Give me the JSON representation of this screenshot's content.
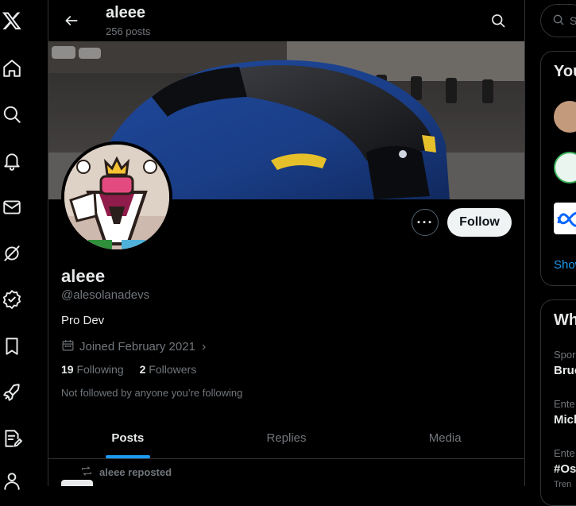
{
  "app": {
    "logo": "X"
  },
  "leftnav": [
    {
      "name": "x-logo-icon"
    },
    {
      "name": "home-icon"
    },
    {
      "name": "explore-search-icon"
    },
    {
      "name": "notifications-bell-icon"
    },
    {
      "name": "messages-envelope-icon"
    },
    {
      "name": "grok-icon"
    },
    {
      "name": "verified-icon"
    },
    {
      "name": "bookmarks-icon"
    },
    {
      "name": "jobs-rocket-icon"
    },
    {
      "name": "write-article-icon"
    },
    {
      "name": "profile-icon"
    }
  ],
  "header": {
    "title": "aleee",
    "subtitle": "256 posts"
  },
  "profile": {
    "name": "aleee",
    "handle": "@alesolanadevs",
    "bio": "Pro Dev",
    "joined": "Joined February 2021",
    "following_count": "19",
    "following_label": "Following",
    "followers_count": "2",
    "followers_label": "Followers",
    "not_followed": "Not followed by anyone you’re following",
    "follow_label": "Follow",
    "more_label": "···"
  },
  "tabs": [
    {
      "label": "Posts",
      "active": true
    },
    {
      "label": "Replies",
      "active": false
    },
    {
      "label": "Media",
      "active": false
    }
  ],
  "feed": {
    "repost_label": "aleee reposted"
  },
  "right": {
    "search_placeholder": "Se",
    "who_to_follow_title": "You",
    "show_more": "Show",
    "whats_happening_title": "Wh",
    "trends": [
      {
        "category": "Spor",
        "name": "Bruc"
      },
      {
        "category": "Ente",
        "name": "Mich"
      },
      {
        "category": "Ente",
        "name": "#Os"
      }
    ],
    "trend_footer": "Tren"
  },
  "colors": {
    "accent": "#1d9bf0",
    "background": "#000000",
    "text": "#e7e9ea",
    "muted": "#71767b",
    "border": "#2f3336"
  }
}
